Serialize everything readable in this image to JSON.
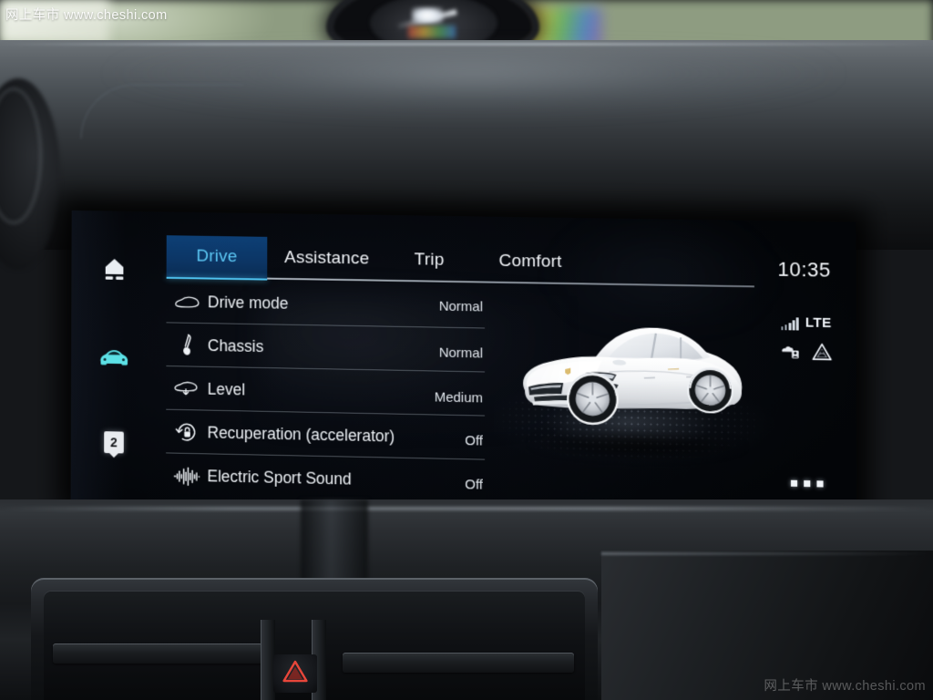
{
  "watermark": {
    "top_left": "网上车市 www.cheshi.com",
    "bottom_right": "网上车市 www.cheshi.com"
  },
  "screen": {
    "rail": {
      "items": [
        {
          "name": "home-icon",
          "label": "Home"
        },
        {
          "name": "car-icon",
          "label": "Vehicle",
          "active": true
        },
        {
          "name": "gear-indicator",
          "label": "2"
        }
      ]
    },
    "tabs": [
      {
        "label": "Drive",
        "active": true
      },
      {
        "label": "Assistance",
        "active": false
      },
      {
        "label": "Trip",
        "active": false
      },
      {
        "label": "Comfort",
        "active": false
      }
    ],
    "settings": [
      {
        "icon": "car-side-icon",
        "label": "Drive mode",
        "value": "Normal"
      },
      {
        "icon": "shock-absorber-icon",
        "label": "Chassis",
        "value": "Normal"
      },
      {
        "icon": "car-level-icon",
        "label": "Level",
        "value": "Medium"
      },
      {
        "icon": "recuperation-icon",
        "label": "Recuperation (accelerator)",
        "value": "Off"
      },
      {
        "icon": "sound-wave-icon",
        "label": "Electric Sport Sound",
        "value": "Off"
      }
    ],
    "status": {
      "clock": "10:35",
      "network": "LTE",
      "signal_bars": 5,
      "icons": [
        {
          "name": "traffic-info-icon"
        },
        {
          "name": "warning-triangle-icon"
        }
      ],
      "overflow_label": "..."
    },
    "vehicle_render": {
      "name": "porsche-taycan-render",
      "body_color": "#ffffff"
    }
  },
  "colors": {
    "accent": "#4fc3f0",
    "tab_active_bg": "#0d3f75",
    "rail_active": "#5ce1e6",
    "hazard": "#e03a2f"
  },
  "hardware": {
    "hazard_button": "hazard-warning-button",
    "vents": "center-air-vents"
  }
}
